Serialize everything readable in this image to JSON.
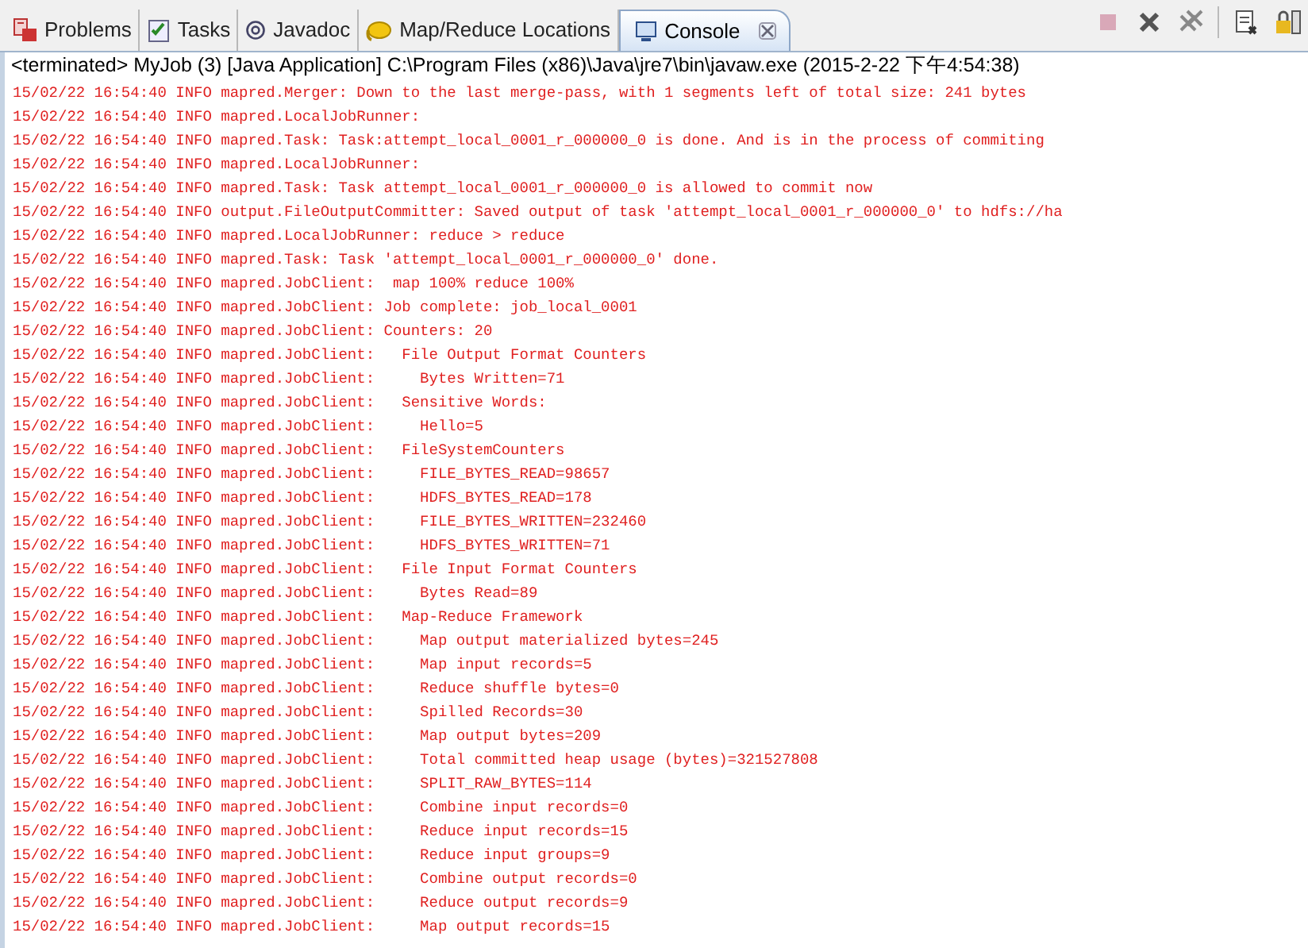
{
  "tabs": [
    {
      "label": "Problems",
      "selected": false
    },
    {
      "label": "Tasks",
      "selected": false
    },
    {
      "label": "Javadoc",
      "selected": false
    },
    {
      "label": "Map/Reduce Locations",
      "selected": false
    },
    {
      "label": "Console",
      "selected": true
    }
  ],
  "toolbar": [
    {
      "disabled": true
    },
    {
      "disabled": false
    },
    {
      "disabled": false
    },
    {
      "disabled": false
    },
    {
      "disabled": false
    }
  ],
  "process_line": "<terminated> MyJob (3) [Java Application] C:\\Program Files (x86)\\Java\\jre7\\bin\\javaw.exe (2015-2-22 下午4:54:38)",
  "console_lines": [
    "15/02/22 16:54:40 INFO mapred.Merger: Down to the last merge-pass, with 1 segments left of total size: 241 bytes",
    "15/02/22 16:54:40 INFO mapred.LocalJobRunner: ",
    "15/02/22 16:54:40 INFO mapred.Task: Task:attempt_local_0001_r_000000_0 is done. And is in the process of commiting",
    "15/02/22 16:54:40 INFO mapred.LocalJobRunner: ",
    "15/02/22 16:54:40 INFO mapred.Task: Task attempt_local_0001_r_000000_0 is allowed to commit now",
    "15/02/22 16:54:40 INFO output.FileOutputCommitter: Saved output of task 'attempt_local_0001_r_000000_0' to hdfs://ha",
    "15/02/22 16:54:40 INFO mapred.LocalJobRunner: reduce > reduce",
    "15/02/22 16:54:40 INFO mapred.Task: Task 'attempt_local_0001_r_000000_0' done.",
    "15/02/22 16:54:40 INFO mapred.JobClient:  map 100% reduce 100%",
    "15/02/22 16:54:40 INFO mapred.JobClient: Job complete: job_local_0001",
    "15/02/22 16:54:40 INFO mapred.JobClient: Counters: 20",
    "15/02/22 16:54:40 INFO mapred.JobClient:   File Output Format Counters ",
    "15/02/22 16:54:40 INFO mapred.JobClient:     Bytes Written=71",
    "15/02/22 16:54:40 INFO mapred.JobClient:   Sensitive Words:",
    "15/02/22 16:54:40 INFO mapred.JobClient:     Hello=5",
    "15/02/22 16:54:40 INFO mapred.JobClient:   FileSystemCounters",
    "15/02/22 16:54:40 INFO mapred.JobClient:     FILE_BYTES_READ=98657",
    "15/02/22 16:54:40 INFO mapred.JobClient:     HDFS_BYTES_READ=178",
    "15/02/22 16:54:40 INFO mapred.JobClient:     FILE_BYTES_WRITTEN=232460",
    "15/02/22 16:54:40 INFO mapred.JobClient:     HDFS_BYTES_WRITTEN=71",
    "15/02/22 16:54:40 INFO mapred.JobClient:   File Input Format Counters ",
    "15/02/22 16:54:40 INFO mapred.JobClient:     Bytes Read=89",
    "15/02/22 16:54:40 INFO mapred.JobClient:   Map-Reduce Framework",
    "15/02/22 16:54:40 INFO mapred.JobClient:     Map output materialized bytes=245",
    "15/02/22 16:54:40 INFO mapred.JobClient:     Map input records=5",
    "15/02/22 16:54:40 INFO mapred.JobClient:     Reduce shuffle bytes=0",
    "15/02/22 16:54:40 INFO mapred.JobClient:     Spilled Records=30",
    "15/02/22 16:54:40 INFO mapred.JobClient:     Map output bytes=209",
    "15/02/22 16:54:40 INFO mapred.JobClient:     Total committed heap usage (bytes)=321527808",
    "15/02/22 16:54:40 INFO mapred.JobClient:     SPLIT_RAW_BYTES=114",
    "15/02/22 16:54:40 INFO mapred.JobClient:     Combine input records=0",
    "15/02/22 16:54:40 INFO mapred.JobClient:     Reduce input records=15",
    "15/02/22 16:54:40 INFO mapred.JobClient:     Reduce input groups=9",
    "15/02/22 16:54:40 INFO mapred.JobClient:     Combine output records=0",
    "15/02/22 16:54:40 INFO mapred.JobClient:     Reduce output records=9",
    "15/02/22 16:54:40 INFO mapred.JobClient:     Map output records=15"
  ]
}
